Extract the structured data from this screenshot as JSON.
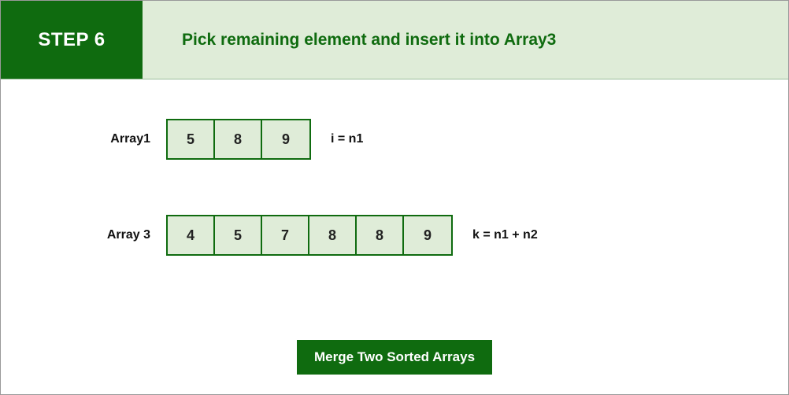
{
  "header": {
    "step_label": "STEP 6",
    "title": "Pick remaining element and insert it into Array3"
  },
  "rows": [
    {
      "label": "Array1",
      "cells": [
        "5",
        "8",
        "9"
      ],
      "note": "i = n1"
    },
    {
      "label": "Array 3",
      "cells": [
        "4",
        "5",
        "7",
        "8",
        "8",
        "9"
      ],
      "note": "k = n1 + n2"
    }
  ],
  "button": {
    "label": "Merge Two Sorted Arrays"
  }
}
